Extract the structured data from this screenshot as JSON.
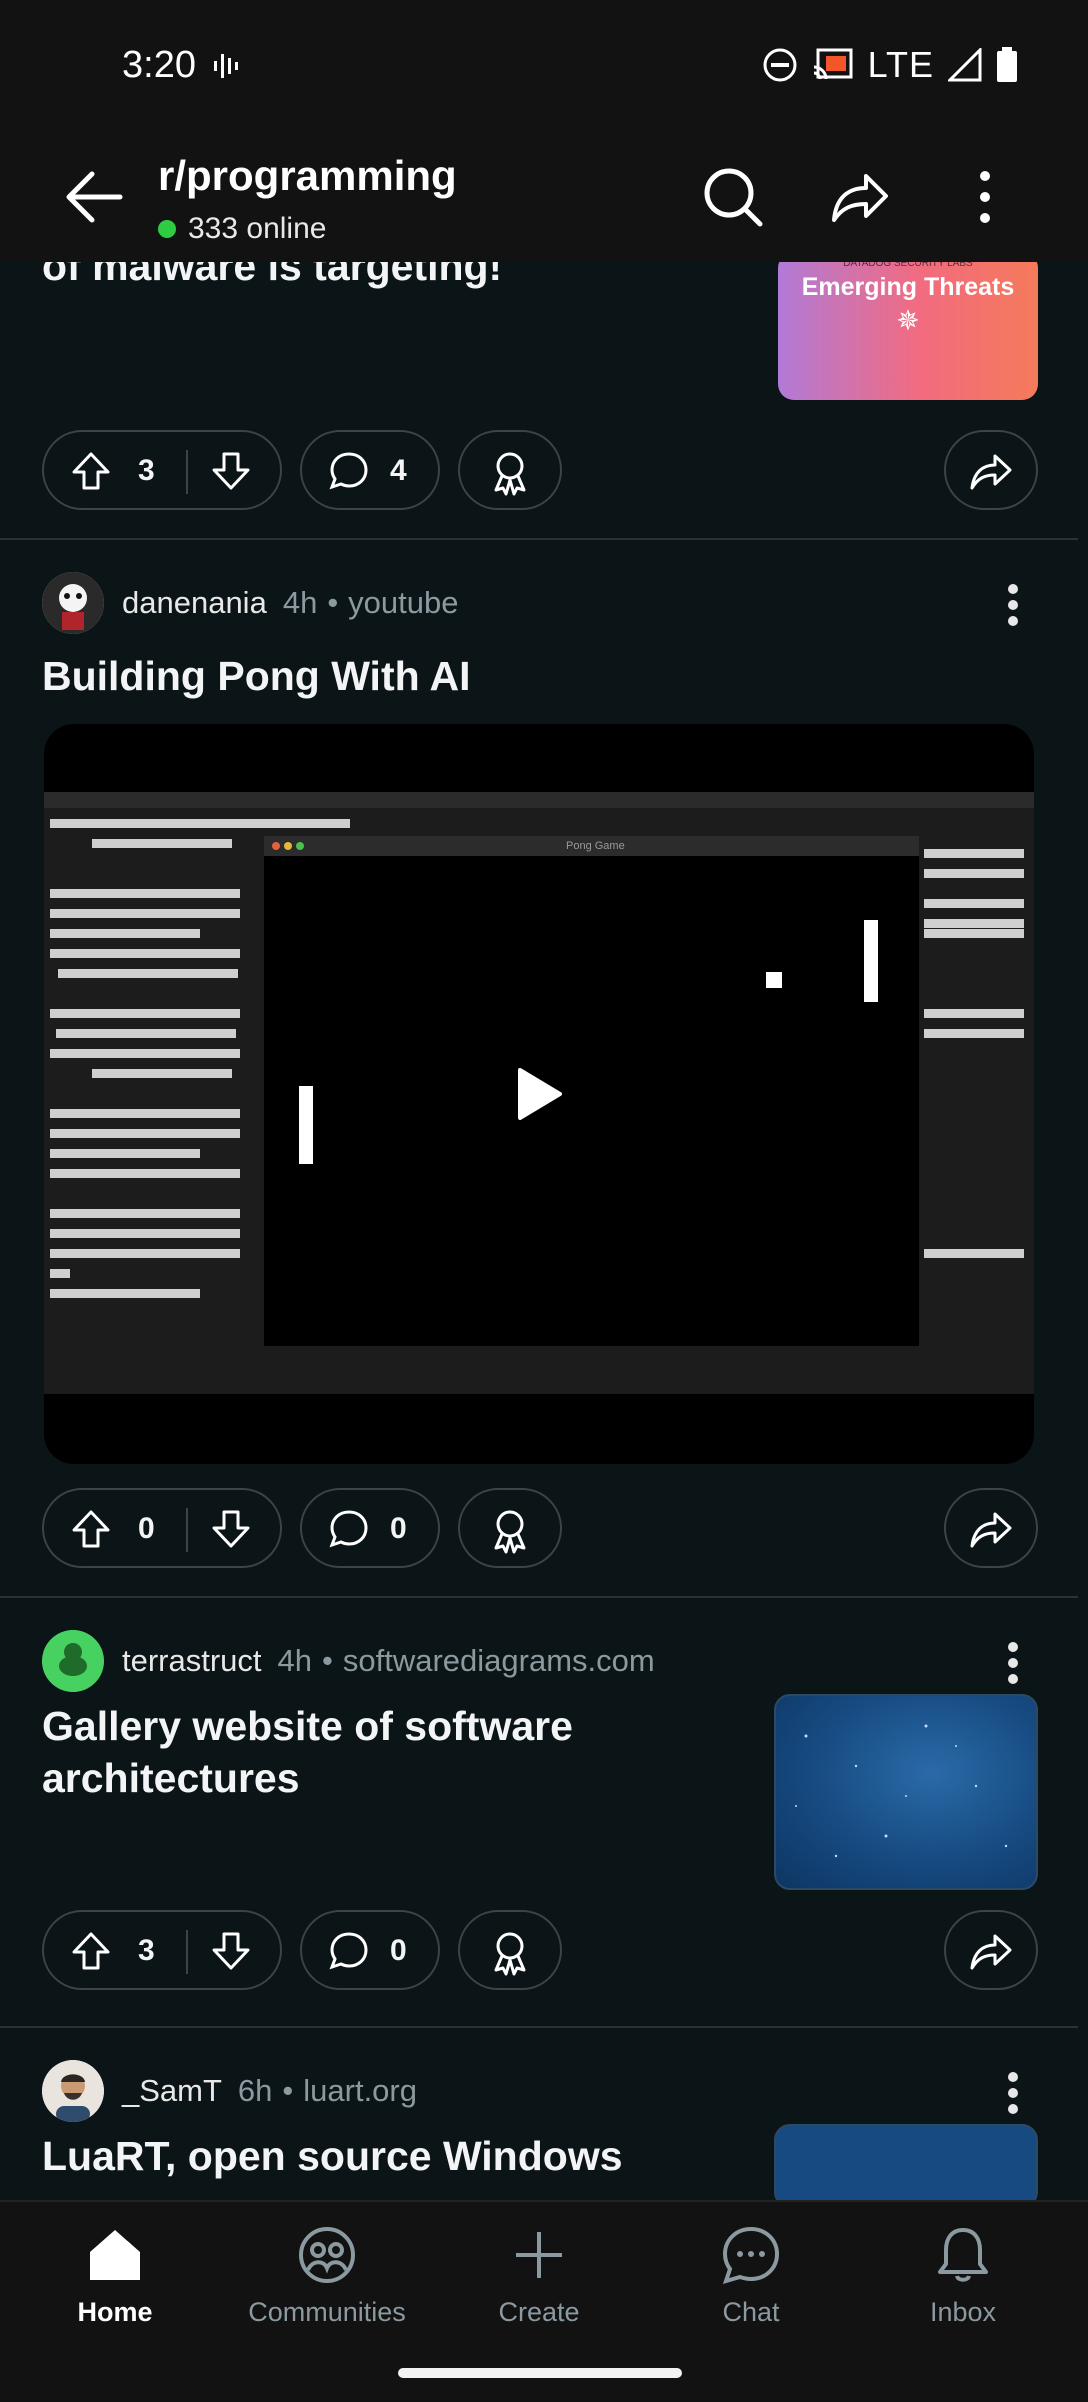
{
  "status": {
    "time": "3:20",
    "network": "LTE"
  },
  "header": {
    "title": "r/programming",
    "online": "333 online"
  },
  "posts": [
    {
      "title": "of malware is targeting!",
      "thumb_small": "DATADOG SECURITY LABS",
      "thumb_title": "Emerging Threats",
      "upvotes": "3",
      "comments": "4"
    },
    {
      "author": "danenania",
      "age": "4h",
      "source": "youtube",
      "title": "Building Pong With AI",
      "video_window_title": "Pong Game",
      "upvotes": "0",
      "comments": "0"
    },
    {
      "author": "terrastruct",
      "age": "4h",
      "source": "softwarediagrams.com",
      "title": "Gallery website of software architectures",
      "upvotes": "3",
      "comments": "0"
    },
    {
      "author": "_SamT",
      "age": "6h",
      "source": "luart.org",
      "title": "LuaRT, open source Windows"
    }
  ],
  "nav": {
    "home": "Home",
    "communities": "Communities",
    "create": "Create",
    "chat": "Chat",
    "inbox": "Inbox"
  },
  "colors": {
    "background": "#0b1416",
    "online_dot": "#2ecc40"
  }
}
